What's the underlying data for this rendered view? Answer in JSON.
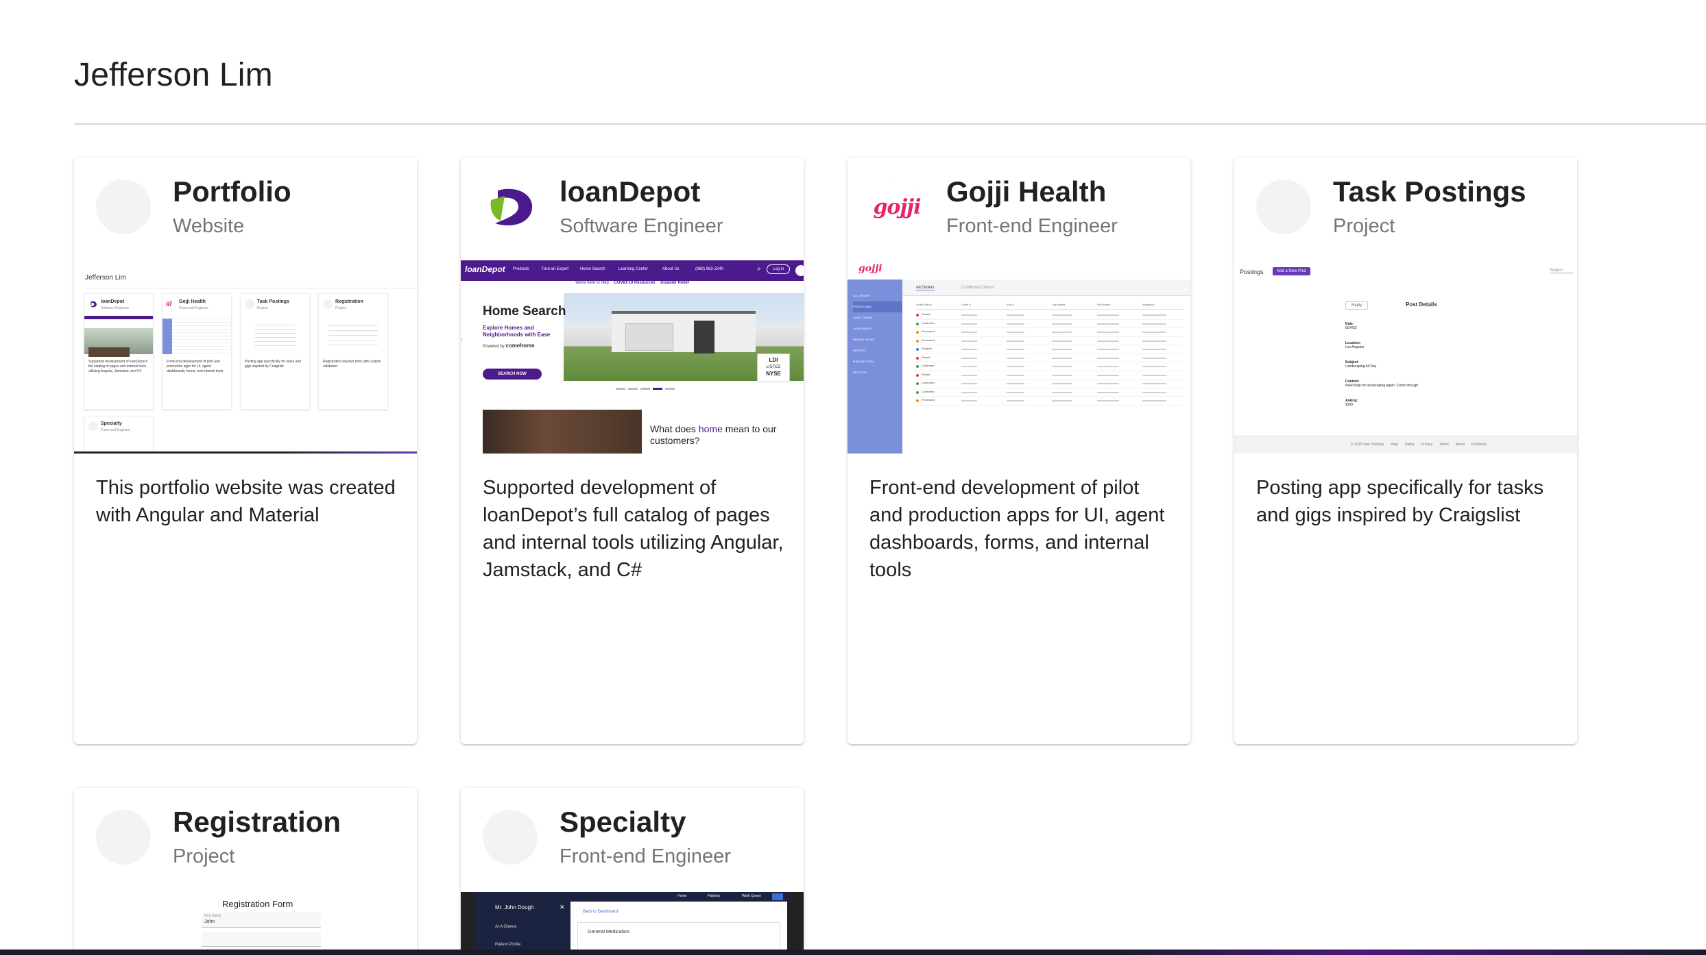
{
  "header": {
    "title": "Jefferson Lim"
  },
  "cards": [
    {
      "title": "Portfolio",
      "subtitle": "Website",
      "description": "This portfolio website was created with Angular and Material",
      "avatar": "blank",
      "preview": {
        "title": "Jefferson Lim",
        "mini_cards": [
          {
            "title": "loanDepot",
            "subtitle": "Software Engineer",
            "text": "Supported development of loanDepot's full catalog of pages and internal tools utilizing Angular, Jamstack, and C#"
          },
          {
            "title": "Gojji Health",
            "subtitle": "Front-end Engineer",
            "text": "Front-end development of pilot and production apps for UI, agent dashboards, forms, and internal tools"
          },
          {
            "title": "Task Postings",
            "subtitle": "Project",
            "text": "Posting app specifically for tasks and gigs inspired by Craigslist"
          },
          {
            "title": "Registration",
            "subtitle": "Project",
            "text": "Registration-inactive form with custom validation"
          },
          {
            "title": "Specialty",
            "subtitle": "Front-end Engineer",
            "text": ""
          }
        ]
      }
    },
    {
      "title": "loanDepot",
      "subtitle": "Software Engineer",
      "description": "Supported development of loanDepot’s full catalog of pages and internal tools utilizing Angular, Jamstack, and C#",
      "avatar": "loandepot-logo",
      "preview": {
        "logo": "loanDepot",
        "nav": [
          "Products",
          "Find an Expert",
          "Home Search",
          "Learning Center",
          "About Us",
          "(888) 983-3240"
        ],
        "login": "Log in",
        "help_banner": "We're here to help",
        "help_links": [
          "COVID-19 Resources",
          "Disaster Relief"
        ],
        "hero_title": "Home Search",
        "hero_sub": "Explore Homes and Neighborhoods with Ease",
        "powered_by": "Powered by",
        "powered_brand": "comehome",
        "cta": "SEARCH NOW",
        "ldi_badge": [
          "LDI",
          "LISTED",
          "NYSE"
        ],
        "home_question_1": "What does",
        "home_question_home": "home",
        "home_question_2": "mean to our customers?"
      }
    },
    {
      "title": "Gojji Health",
      "subtitle": "Front-end Engineer",
      "description": "Front-end development of pilot and production apps for UI, agent dashboards, forms, and internal tools",
      "avatar": "gojji-logo",
      "avatar_text": "gojji",
      "preview": {
        "logo": "gojji",
        "tabs": [
          "All Orders",
          "Confirmed Orders"
        ],
        "sidebar": [
          "ALL ORDERS",
          "POSTS LABEL",
          "ALERT ORDER",
          "CARE ORDER",
          "REVIEW ORDER",
          "REPORTS",
          "MANAGE FORM",
          "SETTINGS"
        ],
        "columns": [
          "Order Status",
          "Order #",
          "Acct #",
          "Last Name",
          "First Name",
          "Insurance"
        ],
        "statuses": [
          "Placed",
          "Confirmed",
          "Processed",
          "Processed",
          "Shipped",
          "Placed",
          "Confirmed",
          "Placed",
          "Confirmed",
          "Confirmed",
          "Processed"
        ],
        "status_colors": [
          "#e53935",
          "#43a047",
          "#fb8c00",
          "#fb8c00",
          "#1e88e5",
          "#e53935",
          "#43a047",
          "#e53935",
          "#43a047",
          "#43a047",
          "#fb8c00"
        ]
      }
    },
    {
      "title": "Task Postings",
      "subtitle": "Project",
      "description": "Posting app specifically for tasks and gigs inspired by Craigslist",
      "avatar": "blank",
      "preview": {
        "brand": "Postings",
        "add_button": "Add a New Post",
        "search": "Search",
        "reply": "Reply",
        "heading": "Post Details",
        "fields": [
          {
            "label": "Date:",
            "value": "6/24/23"
          },
          {
            "label": "Location:",
            "value": "Los Angeles"
          },
          {
            "label": "Subject:",
            "value": "Landscaping All Day"
          },
          {
            "label": "Content:",
            "value": "Need help for landscaping again. Come through"
          },
          {
            "label": "Asking:",
            "value": "$100"
          }
        ],
        "footer": [
          "© 2023 Task Postings",
          "Help",
          "Safety",
          "Privacy",
          "Terms",
          "About",
          "Feedback"
        ]
      }
    },
    {
      "title": "Registration",
      "subtitle": "Project",
      "description": "",
      "avatar": "blank",
      "preview": {
        "heading": "Registration Form",
        "field_label": "First Name",
        "field_value": "John"
      }
    },
    {
      "title": "Specialty",
      "subtitle": "Front-end Engineer",
      "description": "",
      "avatar": "blank",
      "preview": {
        "patient": "Mr. John Dough",
        "menu": [
          "At A Glance",
          "Patient Profile"
        ],
        "nav": [
          "Home",
          "Patients",
          "Work Queue"
        ],
        "back": "Back to Dashboard",
        "section": "General Medication"
      }
    }
  ],
  "colors": {
    "loandepot_purple": "#4b1a8c",
    "gojji_pink": "#e4246c",
    "gojji_sidebar": "#7b8fdb",
    "accent_purple": "#673ab7"
  }
}
